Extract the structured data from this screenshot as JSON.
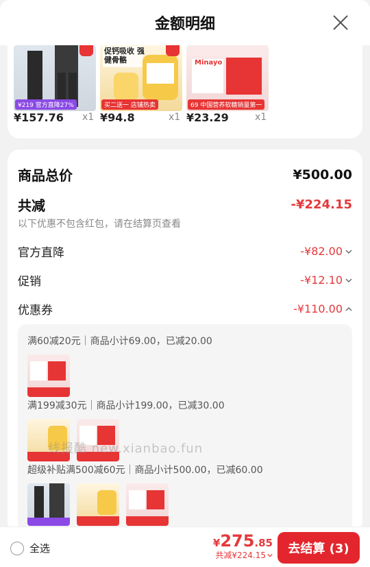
{
  "header": {
    "title": "金额明细"
  },
  "products": [
    {
      "price": "¥157.76",
      "qty": "x1",
      "promo_tag": "官方直降27%",
      "badge": "¥219"
    },
    {
      "price": "¥94.8",
      "qty": "x1",
      "promo_tag": "买二送一 店铺热卖",
      "headline": "促钙吸收 强健骨骼"
    },
    {
      "price": "¥23.29",
      "qty": "x1",
      "promo_tag": "中国营养软糖销量第一",
      "badge": "69",
      "brand": "Minayo"
    }
  ],
  "summary": {
    "total_label": "商品总价",
    "total_value": "¥500.00",
    "discount_label": "共减",
    "discount_value": "-¥224.15",
    "note": "以下优惠不包含红包，请在结算页查看",
    "lines": [
      {
        "label": "官方直降",
        "value": "-¥82.00"
      },
      {
        "label": "促销",
        "value": "-¥12.10"
      },
      {
        "label": "优惠券",
        "value": "-¥110.00"
      }
    ]
  },
  "coupons": [
    {
      "text": "满60减20元｜商品小计69.00，已减20.00"
    },
    {
      "text": "满199减30元｜商品小计199.00，已减30.00"
    },
    {
      "text": "超级补贴满500减60元｜商品小计500.00，已减60.00"
    }
  ],
  "watermark": "线报酷 new.xianbao.fun",
  "footer": {
    "select_all": "全选",
    "currency": "¥",
    "amount_int": "275",
    "amount_dec": ".85",
    "saved": "共减¥224.15",
    "checkout_label": "去结算 (3)"
  },
  "colors": {
    "accent": "#e3262d",
    "discount": "#e4393c"
  }
}
